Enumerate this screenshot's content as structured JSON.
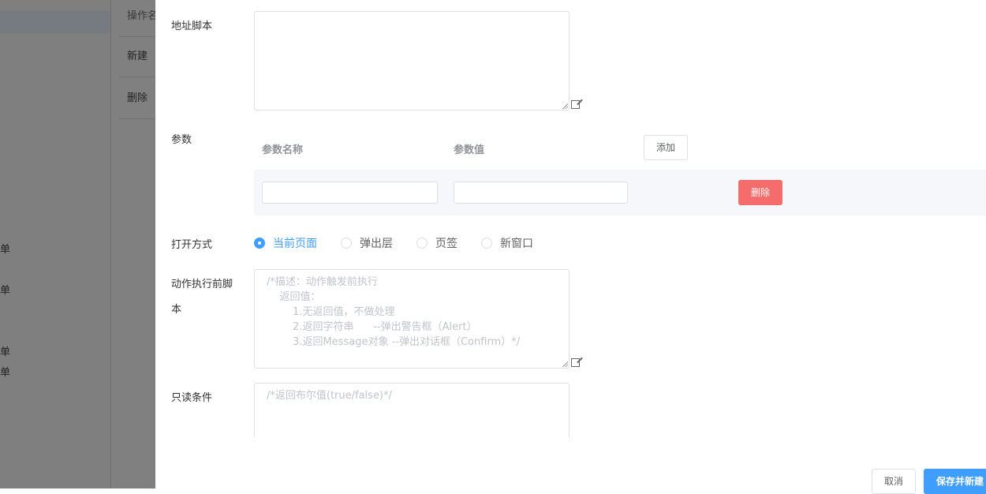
{
  "background": {
    "left_fragments": [
      "单",
      "单",
      "单",
      "单"
    ],
    "columns": {
      "header": "操作名",
      "rows": [
        "新建",
        "删除"
      ]
    }
  },
  "form": {
    "url_script": {
      "label": "地址脚本",
      "value": ""
    },
    "params": {
      "label": "参数",
      "col_name": "参数名称",
      "col_value": "参数值",
      "add_label": "添加",
      "rows": [
        {
          "name": "",
          "value": "",
          "delete_label": "删除"
        }
      ]
    },
    "open_mode": {
      "label": "打开方式",
      "options": [
        "当前页面",
        "弹出层",
        "页签",
        "新窗口"
      ],
      "selected": "当前页面"
    },
    "pre_script": {
      "label_line1": "动作执行前脚",
      "label_line2": "本",
      "placeholder": "/*描述：动作触发前执行\n    返回值：\n        1.无返回值，不做处理\n        2.返回字符串      --弹出警告框（Alert）\n        3.返回Message对象 --弹出对话框（Confirm）*/"
    },
    "readonly": {
      "label": "只读条件",
      "placeholder": "/*返回布尔值(true/false)*/"
    }
  },
  "footer": {
    "cancel_label": "取消",
    "save_label": "保存并新建"
  },
  "colors": {
    "primary": "#409eff",
    "danger": "#f56c6c",
    "overlay": "#808080"
  }
}
